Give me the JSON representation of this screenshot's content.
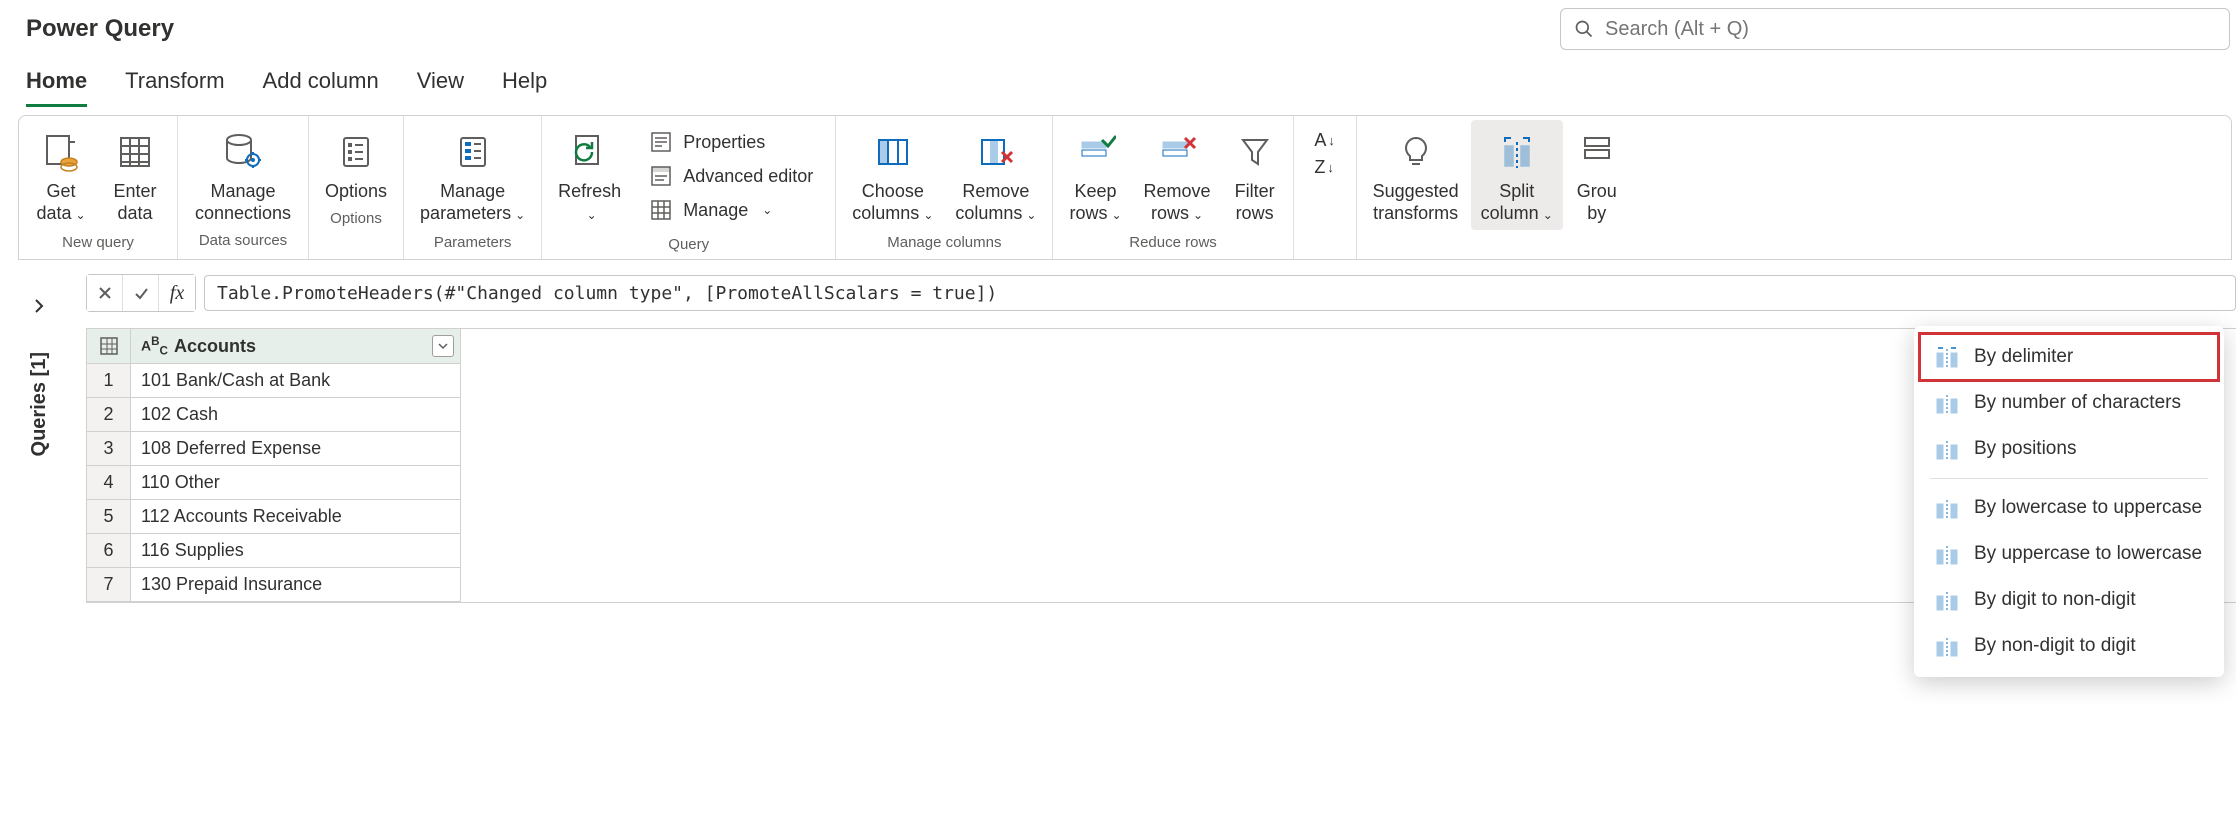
{
  "app_title": "Power Query",
  "search": {
    "placeholder": "Search (Alt + Q)"
  },
  "tabs": [
    "Home",
    "Transform",
    "Add column",
    "View",
    "Help"
  ],
  "active_tab": "Home",
  "ribbon": {
    "new_query": {
      "group_label": "New query",
      "get_data": "Get\ndata",
      "enter_data": "Enter\ndata"
    },
    "data_sources": {
      "group_label": "Data sources",
      "manage_connections": "Manage\nconnections"
    },
    "options": {
      "group_label": "Options",
      "options": "Options"
    },
    "parameters": {
      "group_label": "Parameters",
      "manage_parameters": "Manage\nparameters"
    },
    "query": {
      "group_label": "Query",
      "refresh": "Refresh",
      "properties": "Properties",
      "advanced_editor": "Advanced editor",
      "manage": "Manage"
    },
    "manage_columns": {
      "group_label": "Manage columns",
      "choose_columns": "Choose\ncolumns",
      "remove_columns": "Remove\ncolumns"
    },
    "reduce_rows": {
      "group_label": "Reduce rows",
      "keep_rows": "Keep\nrows",
      "remove_rows": "Remove\nrows",
      "filter_rows": "Filter\nrows"
    },
    "sort_icon": "sort",
    "suggested": "Suggested\ntransforms",
    "split_column": "Split\ncolumn",
    "group_by": "Grou\nby"
  },
  "split_menu": {
    "items": [
      "By delimiter",
      "By number of characters",
      "By positions",
      "By lowercase to uppercase",
      "By uppercase to lowercase",
      "By digit to non-digit",
      "By non-digit to digit"
    ]
  },
  "queries_label": "Queries [1]",
  "formula": "Table.PromoteHeaders(#\"Changed column type\", [PromoteAllScalars = true])",
  "table": {
    "column_header": "Accounts",
    "rows": [
      "101 Bank/Cash at Bank",
      "102 Cash",
      "108 Deferred Expense",
      "110 Other",
      "112 Accounts Receivable",
      "116 Supplies",
      "130 Prepaid Insurance"
    ]
  }
}
